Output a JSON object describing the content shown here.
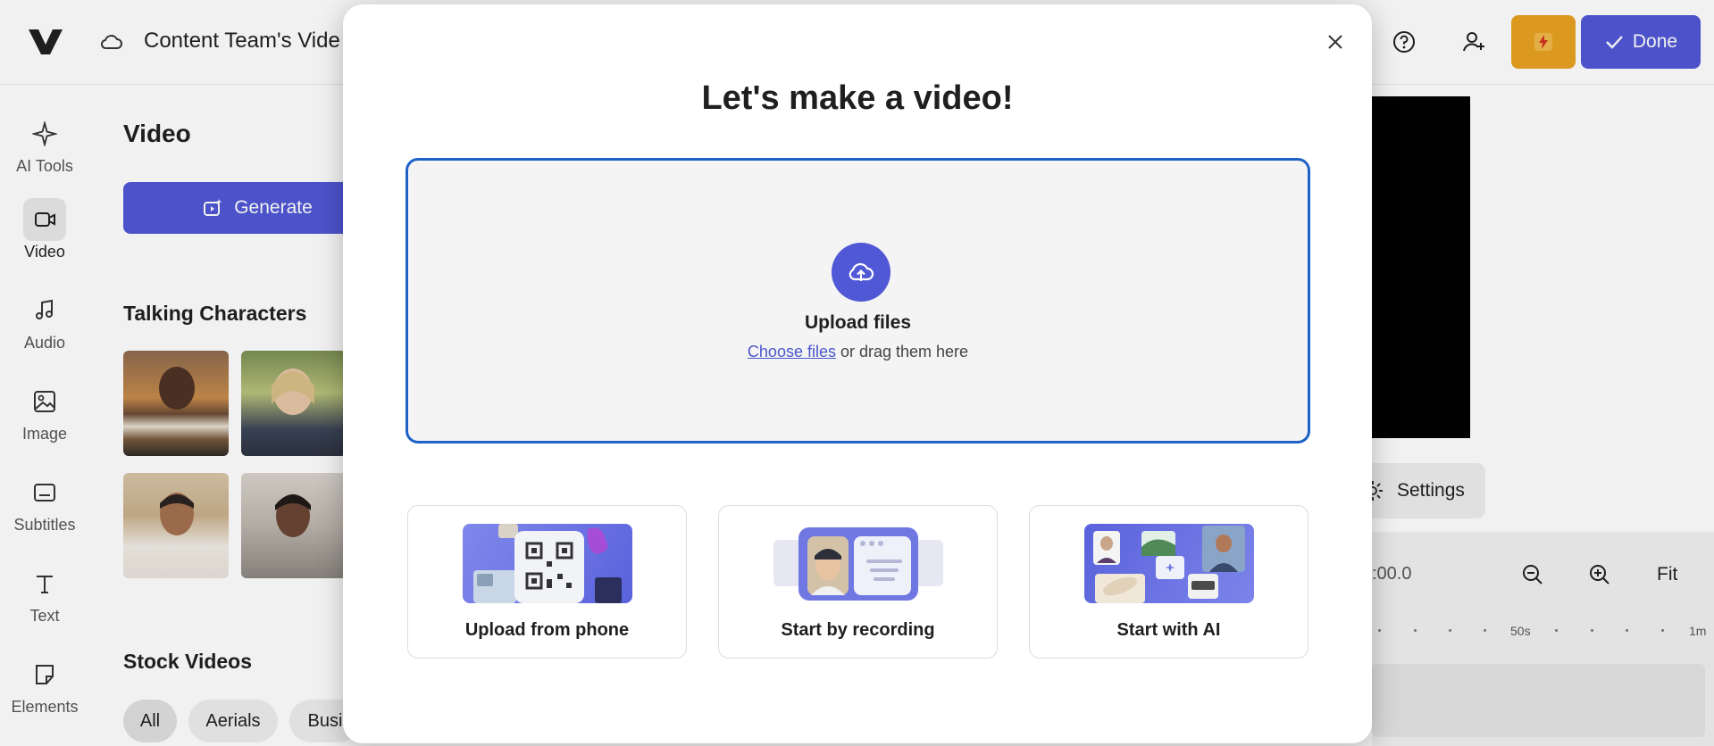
{
  "header": {
    "project_title": "Content Team's Vide",
    "done_label": "Done"
  },
  "sidebar": {
    "items": [
      {
        "label": "AI Tools",
        "icon": "sparkle-icon"
      },
      {
        "label": "Video",
        "icon": "video-camera-icon",
        "active": true
      },
      {
        "label": "Audio",
        "icon": "music-note-icon"
      },
      {
        "label": "Image",
        "icon": "image-icon"
      },
      {
        "label": "Subtitles",
        "icon": "subtitles-icon"
      },
      {
        "label": "Text",
        "icon": "text-icon"
      },
      {
        "label": "Elements",
        "icon": "sticker-icon"
      }
    ]
  },
  "panel": {
    "title": "Video",
    "generate_label": "Generate",
    "talking_characters_title": "Talking Characters",
    "stock_videos_title": "Stock Videos",
    "chips": [
      "All",
      "Aerials",
      "Busi"
    ]
  },
  "preview": {
    "settings_label": "Settings",
    "time_readout": ":00.0",
    "fit_label": "Fit",
    "ruler_labels": [
      "50s",
      "1m"
    ]
  },
  "modal": {
    "title": "Let's make a video!",
    "upload_title": "Upload files",
    "choose_files": "Choose files",
    "drag_text": " or drag them here",
    "options": [
      {
        "label": "Upload from phone"
      },
      {
        "label": "Start by recording"
      },
      {
        "label": "Start with AI"
      }
    ]
  },
  "colors": {
    "brand": "#5058d6",
    "accent_orange": "#e8a221",
    "dropzone_border": "#1e62c6",
    "link": "#4a56c9"
  }
}
